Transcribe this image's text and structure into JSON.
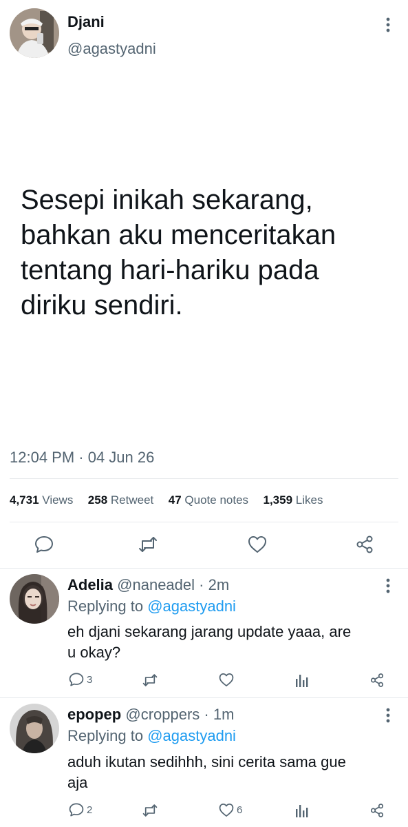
{
  "author": {
    "name": "Djani",
    "handle": "@agastyadni"
  },
  "tweet": {
    "lines": [
      "Sesepi inikah sekarang,",
      "bahkan aku menceritakan",
      "tentang hari-hariku pada",
      "diriku sendiri."
    ],
    "timestamp": "12:04 PM · 04 Jun 26"
  },
  "stats": {
    "views_count": "4,731",
    "views_label": "Views",
    "retweets_count": "258",
    "retweets_label": "Retweet",
    "quotes_count": "47",
    "quotes_label": "Quote notes",
    "likes_count": "1,359",
    "likes_label": "Likes"
  },
  "actions": [
    "reply-icon",
    "retweet-icon",
    "like-icon",
    "share-icon"
  ],
  "replies": [
    {
      "name": "Adelia",
      "handle": "@naneadel",
      "time": "· 2m",
      "replying_prefix": "Replying to",
      "replying_to": "@agastyadni",
      "lines": [
        "eh djani sekarang jarang update yaaa, are",
        "u okay?"
      ],
      "reply_count": "3",
      "like_count": ""
    },
    {
      "name": "epopep",
      "handle": "@croppers",
      "time": "· 1m",
      "replying_prefix": "Replying to",
      "replying_to": "@agastyadni",
      "lines": [
        "aduh ikutan sedihhh, sini cerita sama gue",
        "aja"
      ],
      "reply_count": "2",
      "like_count": "6"
    }
  ],
  "colors": {
    "text": "#0f1419",
    "muted": "#536471",
    "link": "#1d9bf0",
    "divider": "#e6e9ec"
  }
}
